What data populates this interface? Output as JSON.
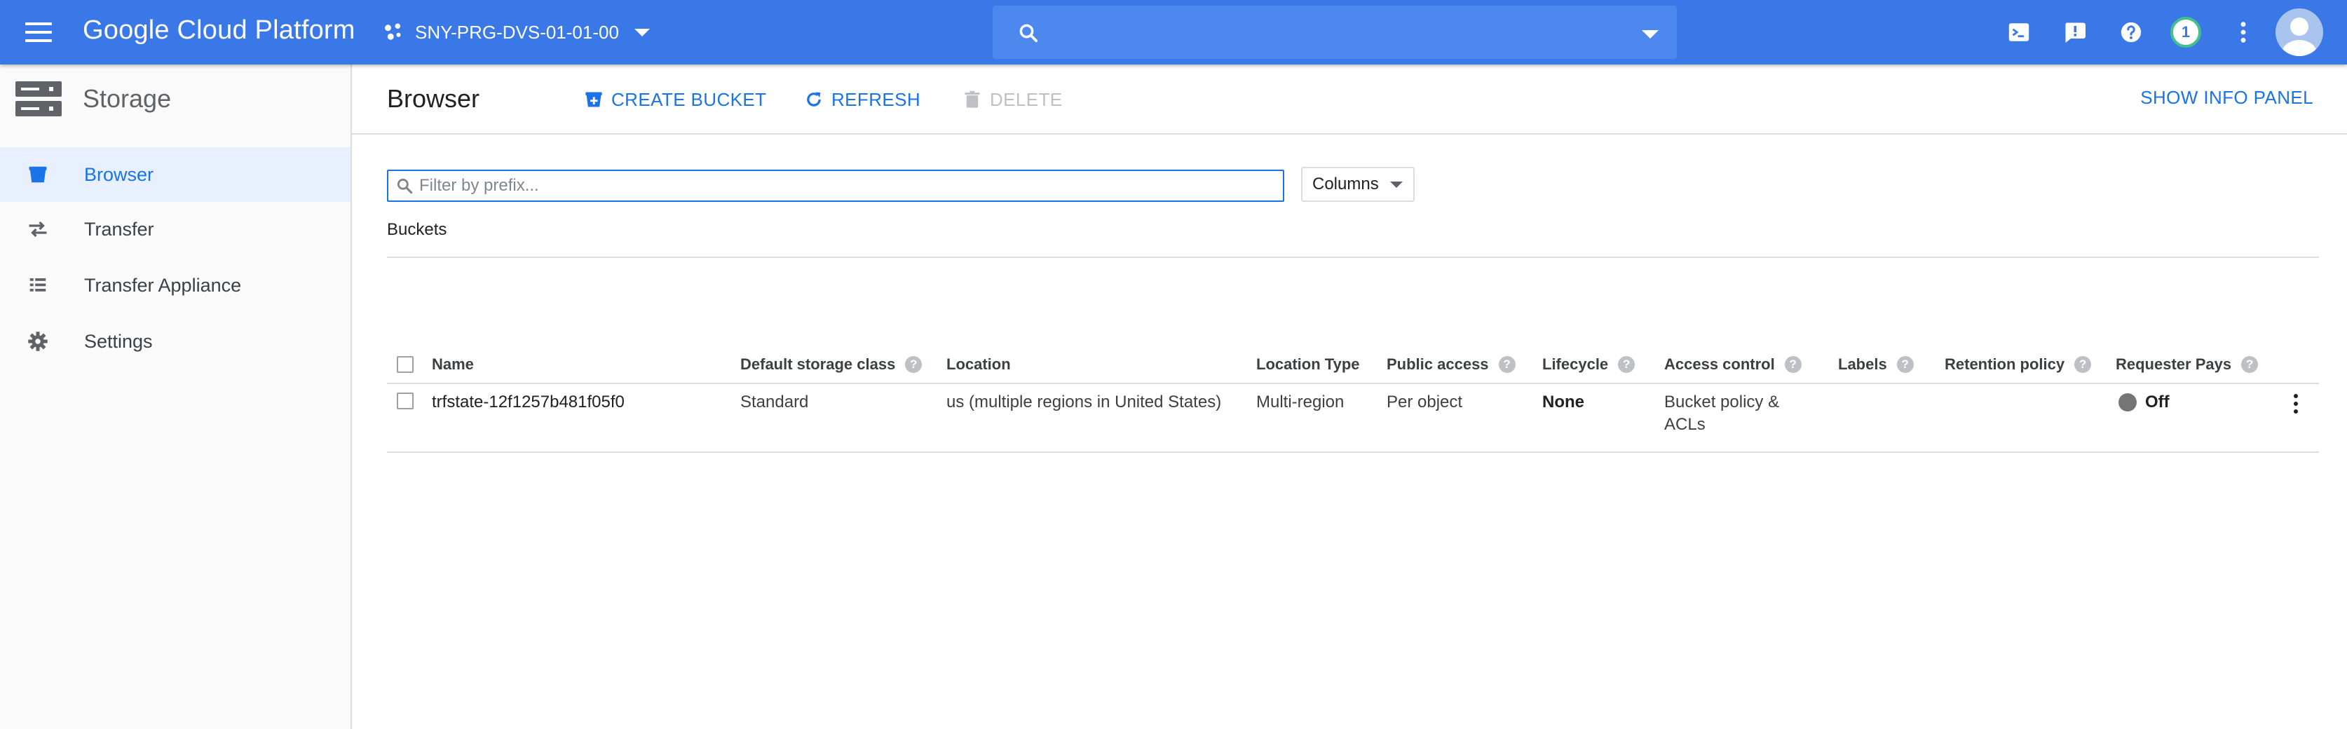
{
  "topbar": {
    "product_name": "Google Cloud Platform",
    "project_name": "SNY-PRG-DVS-01-01-00",
    "search_placeholder": "",
    "notification_count": "1",
    "brand_color": "#3b78e7",
    "icons": [
      "menu-icon",
      "project-dots-icon",
      "search-icon",
      "cloud-shell-icon",
      "feedback-icon",
      "help-icon",
      "more-vert-icon",
      "avatar"
    ]
  },
  "sidebar": {
    "title": "Storage",
    "items": [
      {
        "label": "Browser",
        "icon": "bucket-icon",
        "active": true
      },
      {
        "label": "Transfer",
        "icon": "transfer-arrows-icon",
        "active": false
      },
      {
        "label": "Transfer Appliance",
        "icon": "list-icon",
        "active": false
      },
      {
        "label": "Settings",
        "icon": "gear-icon",
        "active": false
      }
    ]
  },
  "main": {
    "title": "Browser",
    "actions": {
      "create_bucket": "CREATE BUCKET",
      "refresh": "REFRESH",
      "delete": "DELETE",
      "show_info_panel": "SHOW INFO PANEL"
    },
    "filter_placeholder": "Filter by prefix...",
    "columns_label": "Columns",
    "section_label": "Buckets",
    "table": {
      "headers": {
        "name": "Name",
        "storage_class": "Default storage class",
        "location": "Location",
        "location_type": "Location Type",
        "public_access": "Public access",
        "lifecycle": "Lifecycle",
        "access_control": "Access control",
        "labels": "Labels",
        "retention_policy": "Retention policy",
        "requester_pays": "Requester Pays"
      },
      "help_glyph": "?",
      "rows": [
        {
          "name": "trfstate-12f1257b481f05f0",
          "storage_class": "Standard",
          "location": "us (multiple regions in United States)",
          "location_type": "Multi-region",
          "public_access": "Per object",
          "lifecycle": "None",
          "access_control": "Bucket policy & ACLs",
          "labels": "",
          "retention_policy": "",
          "requester_pays": "Off"
        }
      ]
    }
  }
}
